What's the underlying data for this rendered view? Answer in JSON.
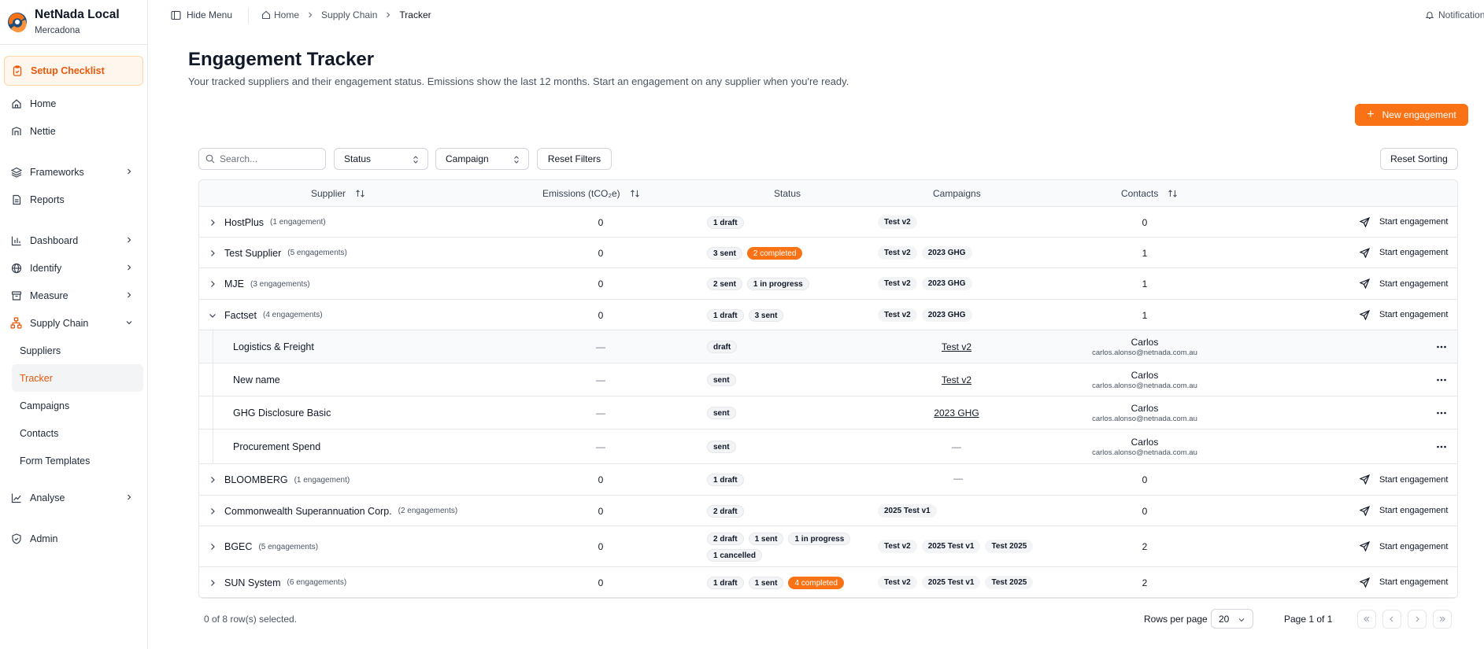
{
  "brand": {
    "title": "NetNada Local",
    "subtitle": "Mercadona"
  },
  "sidebar": {
    "checklist": "Setup Checklist",
    "items": [
      {
        "label": "Home"
      },
      {
        "label": "Nettie"
      },
      {
        "label": "Frameworks"
      },
      {
        "label": "Reports"
      },
      {
        "label": "Dashboard"
      },
      {
        "label": "Identify"
      },
      {
        "label": "Measure"
      },
      {
        "label": "Supply Chain"
      },
      {
        "label": "Analyse"
      },
      {
        "label": "Admin"
      }
    ],
    "supply_chain_sub": [
      "Suppliers",
      "Tracker",
      "Campaigns",
      "Contacts",
      "Form Templates"
    ]
  },
  "topbar": {
    "hide_menu": "Hide Menu",
    "breadcrumb": [
      "Home",
      "Supply Chain",
      "Tracker"
    ],
    "notifications": "Notification"
  },
  "header": {
    "title": "Engagement Tracker",
    "subtitle": "Your tracked suppliers and their engagement status. Emissions show the last 12 months. Start an engagement on any supplier when you're ready.",
    "new_button": "New engagement"
  },
  "filters": {
    "search_placeholder": "Search...",
    "status": "Status",
    "campaign": "Campaign",
    "reset_filters": "Reset Filters",
    "reset_sorting": "Reset Sorting"
  },
  "table": {
    "columns": [
      "Supplier",
      "Emissions (tCO₂e)",
      "Status",
      "Campaigns",
      "Contacts"
    ],
    "start_label": "Start engagement",
    "rows": [
      {
        "name": "HostPlus",
        "count": "(1 engagement)",
        "emissions": "0",
        "statuses": [
          "1 draft"
        ],
        "campaigns": [
          "Test v2"
        ],
        "contacts": "0"
      },
      {
        "name": "Test Supplier",
        "count": "(5 engagements)",
        "emissions": "0",
        "statuses": [
          "3 sent",
          "2 completed"
        ],
        "campaigns": [
          "Test v2",
          "2023 GHG"
        ],
        "contacts": "1"
      },
      {
        "name": "MJE",
        "count": "(3 engagements)",
        "emissions": "0",
        "statuses": [
          "2 sent",
          "1 in progress"
        ],
        "campaigns": [
          "Test v2",
          "2023 GHG"
        ],
        "contacts": "1"
      },
      {
        "name": "Factset",
        "count": "(4 engagements)",
        "emissions": "0",
        "statuses": [
          "1 draft",
          "3 sent"
        ],
        "campaigns": [
          "Test v2",
          "2023 GHG"
        ],
        "contacts": "1"
      },
      {
        "name": "BLOOMBERG",
        "count": "(1 engagement)",
        "emissions": "0",
        "statuses": [
          "1 draft"
        ],
        "campaigns": [],
        "campaign_empty": "—",
        "contacts": "0"
      },
      {
        "name": "Commonwealth Superannuation Corp.",
        "count": "(2 engagements)",
        "emissions": "0",
        "statuses": [
          "2 draft"
        ],
        "campaigns": [
          "2025 Test v1"
        ],
        "contacts": "0"
      },
      {
        "name": "BGEC",
        "count": "(5 engagements)",
        "emissions": "0",
        "statuses": [
          "2 draft",
          "1 sent",
          "1 in progress",
          "1 cancelled"
        ],
        "campaigns": [
          "Test v2",
          "2025 Test v1",
          "Test 2025"
        ],
        "contacts": "2"
      },
      {
        "name": "SUN System",
        "count": "(6 engagements)",
        "emissions": "0",
        "statuses": [
          "1 draft",
          "1 sent",
          "4 completed"
        ],
        "campaigns": [
          "Test v2",
          "2025 Test v1",
          "Test 2025"
        ],
        "contacts": "2"
      }
    ],
    "factset_children": [
      {
        "name": "Logistics & Freight",
        "emissions": "—",
        "status": "draft",
        "campaign": "Test v2",
        "contact_name": "Carlos",
        "contact_email": "carlos.alonso@netnada.com.au"
      },
      {
        "name": "New name",
        "emissions": "—",
        "status": "sent",
        "campaign": "Test v2",
        "contact_name": "Carlos",
        "contact_email": "carlos.alonso@netnada.com.au"
      },
      {
        "name": "GHG Disclosure Basic",
        "emissions": "—",
        "status": "sent",
        "campaign": "2023 GHG",
        "contact_name": "Carlos",
        "contact_email": "carlos.alonso@netnada.com.au"
      },
      {
        "name": "Procurement Spend",
        "emissions": "—",
        "status": "sent",
        "campaign": "—",
        "contact_name": "Carlos",
        "contact_email": "carlos.alonso@netnada.com.au"
      }
    ]
  },
  "footer": {
    "selected": "0 of 8 row(s) selected.",
    "rows_per_page_label": "Rows per page",
    "rows_per_page": "20",
    "page_of": "Page 1 of 1"
  },
  "colors": {
    "accent": "#f97316",
    "border": "#e5e7eb"
  }
}
